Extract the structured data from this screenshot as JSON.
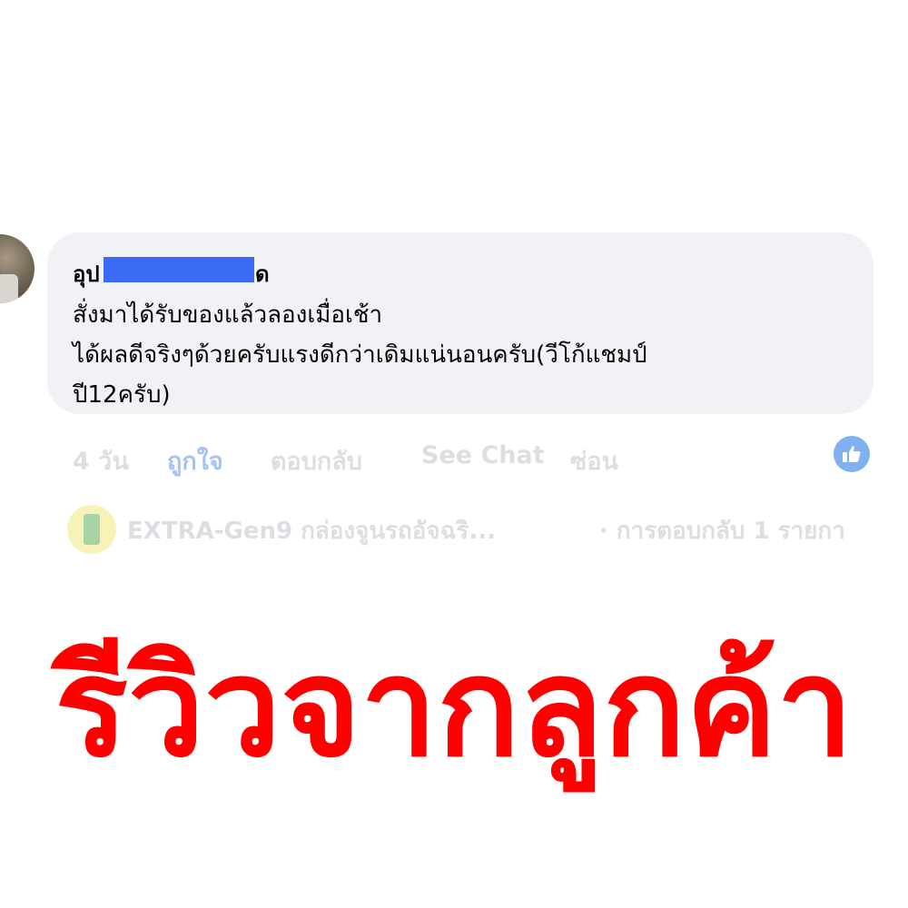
{
  "comment": {
    "author_prefix": "อุป",
    "author_suffix": "ด",
    "lines": [
      "สั่งมาได้รับของแล้วลองเมื่อเช้า",
      "ได้ผลดีจริงๆด้วยครับแรงดีกว่าเดิมแน่นอนครับ(วีโก้แชมป์",
      "ปี12ครับ)"
    ]
  },
  "actions": {
    "time": "4 วัน",
    "like": "ถูกใจ",
    "reply": "ตอบกลับ",
    "see_chat": "See Chat",
    "hide": "ซ่อน"
  },
  "reply_summary": {
    "page_name": "EXTRA-Gen9 กล่องจูนรถอัจฉริ...",
    "count_text": "· การตอบกลับ 1 รายกา"
  },
  "headline": "รีวิวจากลูกค้า",
  "colors": {
    "headline": "#ff0000",
    "bubble": "#f0f2f5",
    "redaction": "#3b6bf5",
    "like_action": "#a8c2ee"
  },
  "icons": {
    "like_reaction": "thumbs-up-icon",
    "user_avatar": "avatar",
    "page_avatar": "page-avatar"
  }
}
